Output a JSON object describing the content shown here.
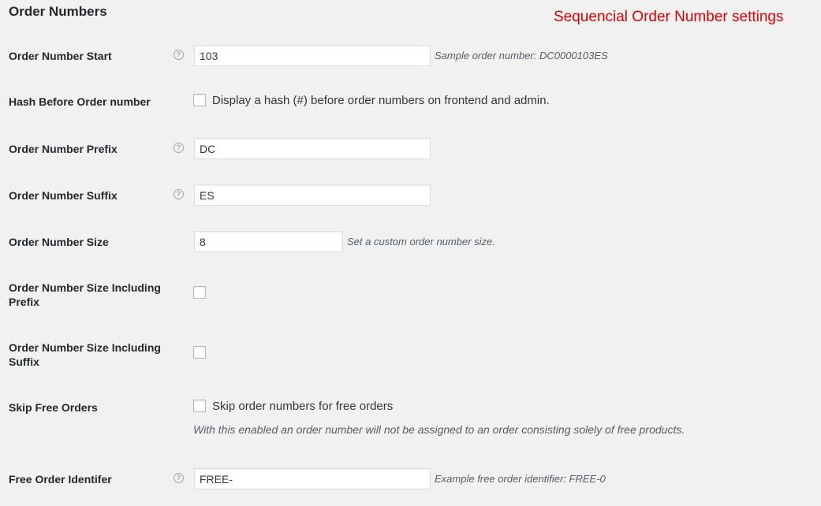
{
  "section_title": "Order Numbers",
  "annotation": "Sequencial Order Number settings",
  "fields": {
    "order_number_start": {
      "label": "Order Number Start",
      "help_icon": "help-icon",
      "value": "103",
      "description": "Sample order number: DC0000103ES"
    },
    "hash_before_order_number": {
      "label": "Hash Before Order number",
      "checked": false,
      "checkbox_label": "Display a hash (#) before order numbers on frontend and admin."
    },
    "order_number_prefix": {
      "label": "Order Number Prefix",
      "help_icon": "help-icon",
      "value": "DC"
    },
    "order_number_suffix": {
      "label": "Order Number Suffix",
      "help_icon": "help-icon",
      "value": "ES"
    },
    "order_number_size": {
      "label": "Order Number Size",
      "value": "8",
      "description": "Set a custom order number size."
    },
    "size_including_prefix": {
      "label": "Order Number Size Including Prefix",
      "checked": false
    },
    "size_including_suffix": {
      "label": "Order Number Size Including Suffix",
      "checked": false
    },
    "skip_free_orders": {
      "label": "Skip Free Orders",
      "checked": false,
      "checkbox_label": "Skip order numbers for free orders",
      "description": "With this enabled an order number will not be assigned to an order consisting solely of free products."
    },
    "free_order_identifier": {
      "label": "Free Order Identifer",
      "help_icon": "help-icon",
      "value": "FREE-",
      "description": "Example free order identifier: FREE-0"
    }
  },
  "colors": {
    "background": "#f1f1f1",
    "annotation": "#e00000",
    "label": "#23282d",
    "description": "#555d66"
  }
}
